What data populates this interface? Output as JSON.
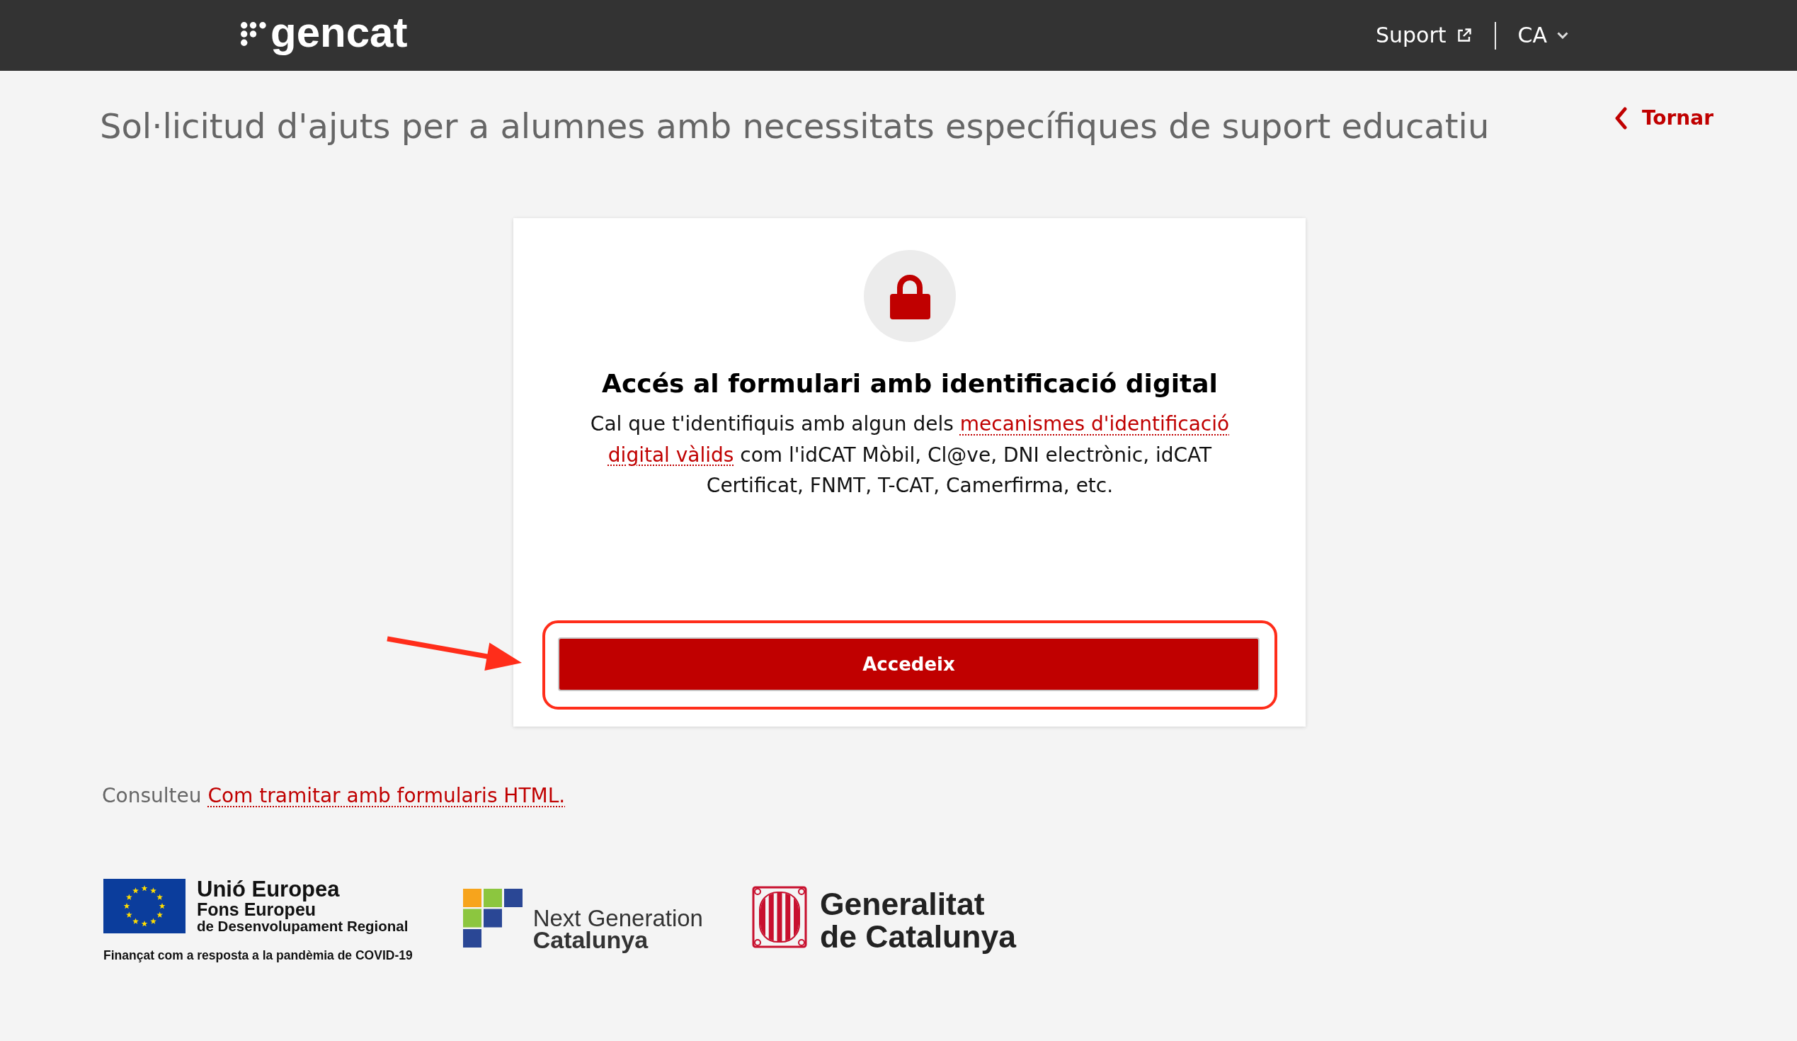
{
  "header": {
    "logo": "gencat",
    "support_link": "Suport",
    "language": "CA"
  },
  "page": {
    "title": "Sol·licitud d'ajuts per a alumnes amb necessitats específiques de suport educatiu",
    "back_link": "Tornar"
  },
  "card": {
    "heading": "Accés al formulari amb identificació digital",
    "text": [
      {
        "kind": "text",
        "text": "Cal que t'identifiquis amb algun dels"
      },
      {
        "kind": "link",
        "text": "mecanismes d'identificació"
      },
      {
        "kind": "link",
        "text": "digital vàlids"
      },
      {
        "kind": "text",
        "text": "com l'idCAT Mòbil, Cl@ve, DNI electrònic, idCAT Certificat, FNMT, T-CAT, Camerfirma, etc."
      }
    ],
    "button": {
      "label": "Accedeix",
      "highlighted": true
    }
  },
  "help": {
    "text": "Consulteu",
    "link": "Com tramitar amb formularis HTML."
  },
  "footer": {
    "eu_logo": {
      "title": "Unió Europea",
      "fund": "Fons Europeu",
      "fund_detail": "de Desenvolupament Regional",
      "note": "Finançat com a resposta a la pandèmia de COVID-19"
    },
    "next_generation_logo": {
      "line_1": "Next Generation",
      "line_2": "Catalunya"
    },
    "generalitat_logo": {
      "line_1": "Generalitat",
      "line_2": "de Catalunya"
    }
  }
}
